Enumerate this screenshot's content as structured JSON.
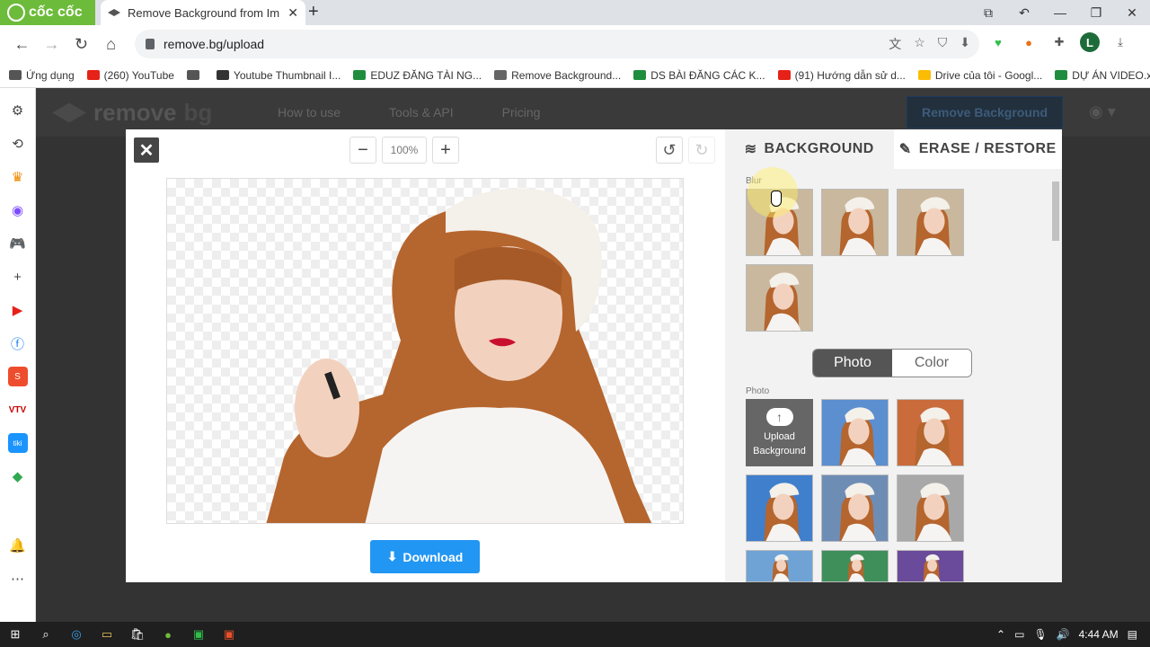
{
  "browser": {
    "brand": "cốc cốc",
    "tab_title": "Remove Background from Im",
    "url": "remove.bg/upload",
    "profile_initial": "L"
  },
  "bookmarks": [
    {
      "label": "Ứng dụng",
      "color": "#555555"
    },
    {
      "label": "(260) YouTube",
      "color": "#e62117"
    },
    {
      "label": "",
      "color": "#555555"
    },
    {
      "label": "Youtube Thumbnail I...",
      "color": "#333333"
    },
    {
      "label": "EDUZ ĐĂNG TÀI NG...",
      "color": "#1e8e3e"
    },
    {
      "label": "Remove Background...",
      "color": "#666666"
    },
    {
      "label": "DS BÀI ĐĂNG CÁC K...",
      "color": "#1e8e3e"
    },
    {
      "label": "(91) Hướng dẫn sử d...",
      "color": "#e62117"
    },
    {
      "label": "Drive của tôi - Googl...",
      "color": "#fbbc04"
    },
    {
      "label": "DỰ ÁN VIDEO.xlsx -...",
      "color": "#1e8e3e"
    }
  ],
  "site": {
    "logo_text": "remove",
    "logo_suffix": "bg",
    "nav": [
      "How to use",
      "Tools & API",
      "Pricing"
    ],
    "cta": "Remove Background"
  },
  "editor": {
    "zoom_value": "100%",
    "download_label": "Download",
    "tabs": {
      "background": "BACKGROUND",
      "erase": "ERASE / RESTORE"
    },
    "blur_label": "Blur",
    "photo_label": "Photo",
    "toggle": {
      "photo": "Photo",
      "color": "Color"
    },
    "upload_label_1": "Upload",
    "upload_label_2": "Background"
  },
  "taskbar": {
    "time": "4:44 AM"
  }
}
